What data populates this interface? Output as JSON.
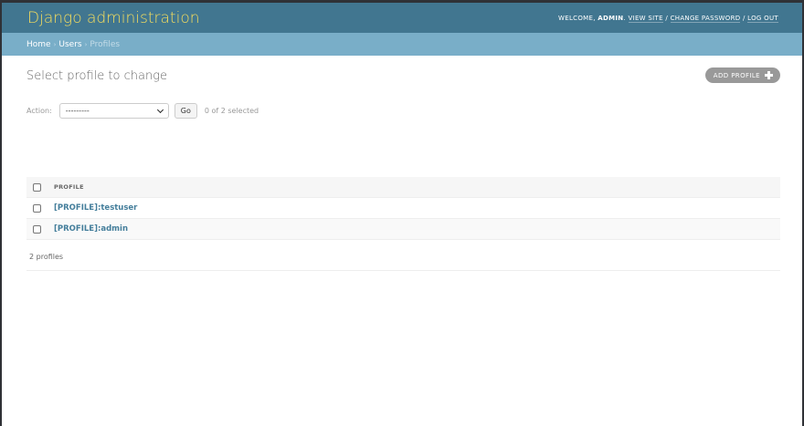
{
  "header": {
    "site_name": "Django administration",
    "welcome_prefix": "WELCOME, ",
    "username": "ADMIN",
    "welcome_suffix": ". ",
    "view_site": "VIEW SITE",
    "sep1": " / ",
    "change_password": "CHANGE PASSWORD",
    "sep2": " / ",
    "log_out": "LOG OUT"
  },
  "breadcrumbs": {
    "home": "Home",
    "sep1": "›",
    "app": "Users",
    "sep2": "›",
    "current": "Profiles"
  },
  "page": {
    "title": "Select profile to change",
    "add_button": "ADD PROFILE"
  },
  "actions": {
    "label": "Action:",
    "selected_value": "---------",
    "go_label": "Go",
    "selected_count": "0 of 2 selected"
  },
  "table": {
    "column_header": "PROFILE",
    "rows": [
      {
        "label": "[PROFILE]:testuser"
      },
      {
        "label": "[PROFILE]:admin"
      }
    ]
  },
  "paginator": {
    "count": "2 profiles"
  },
  "colors": {
    "header_bg": "#417690",
    "brand_text": "#f5dd5d",
    "breadcrumbs_bg": "#79aec8",
    "link": "#447e9b",
    "add_button_bg": "#999999"
  },
  "icons": {
    "add": "plus-icon",
    "select": "chevron-down-icon"
  }
}
